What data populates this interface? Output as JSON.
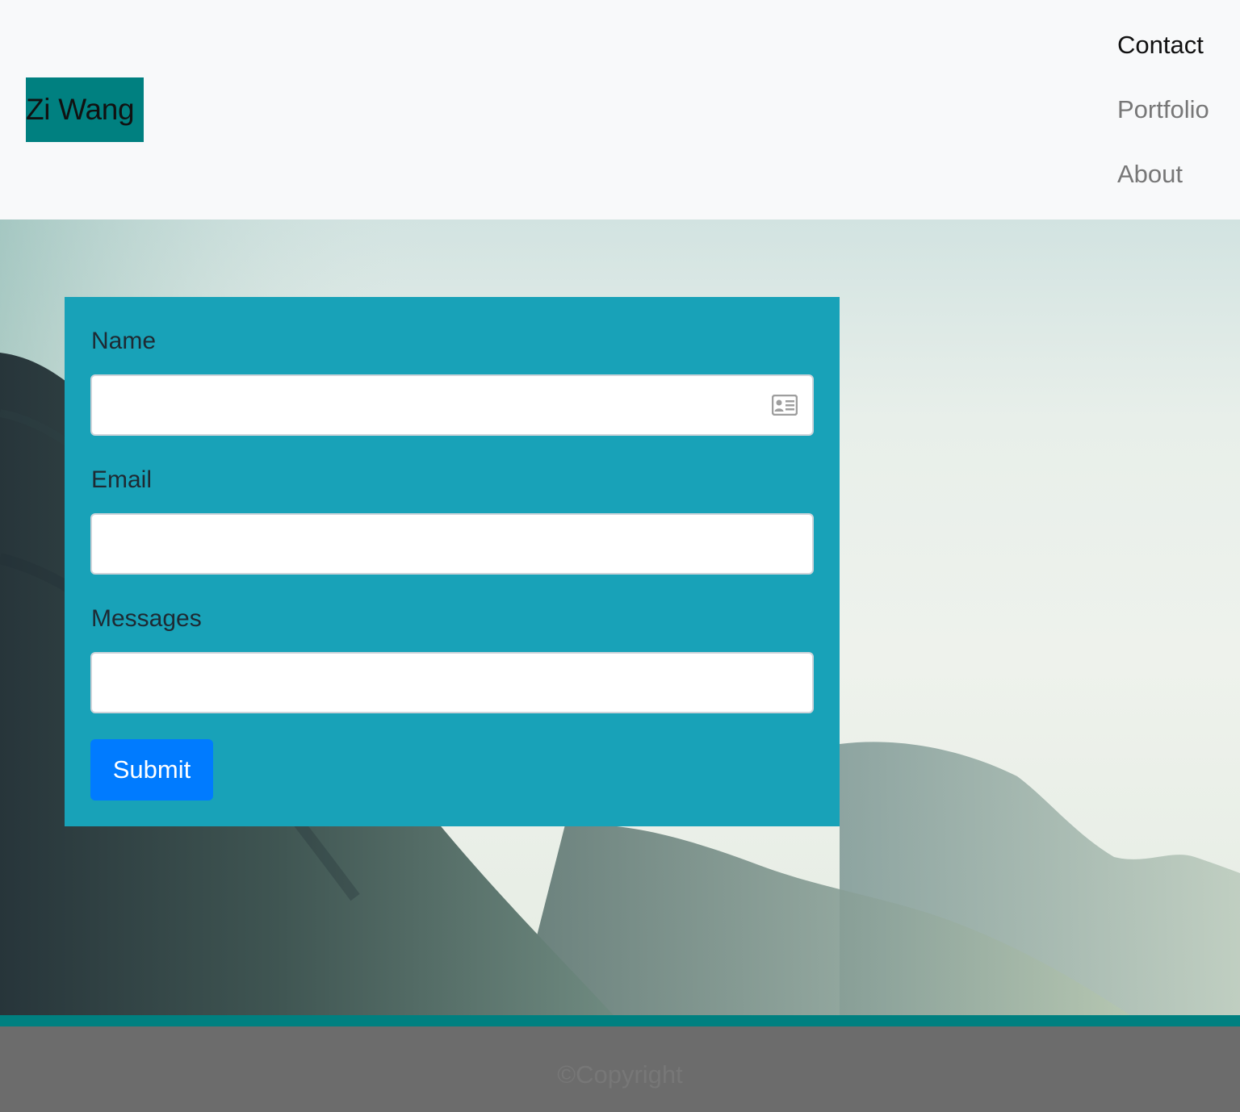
{
  "header": {
    "brand": "Zi Wang",
    "nav": [
      {
        "label": "Contact",
        "active": true
      },
      {
        "label": "Portfolio",
        "active": false
      },
      {
        "label": "About",
        "active": false
      }
    ]
  },
  "form": {
    "name_label": "Name",
    "name_value": "",
    "name_icon": "contact-card-icon",
    "email_label": "Email",
    "email_value": "",
    "messages_label": "Messages",
    "messages_value": "",
    "submit_label": "Submit"
  },
  "footer": {
    "copyright": "©Copyright"
  },
  "colors": {
    "brand_bg": "#008080",
    "form_bg": "#18a2b8",
    "button": "#007bff",
    "footer_bg": "#6c6c6c",
    "footer_bar": "#008080",
    "navbar_bg": "#f8f9fa"
  }
}
